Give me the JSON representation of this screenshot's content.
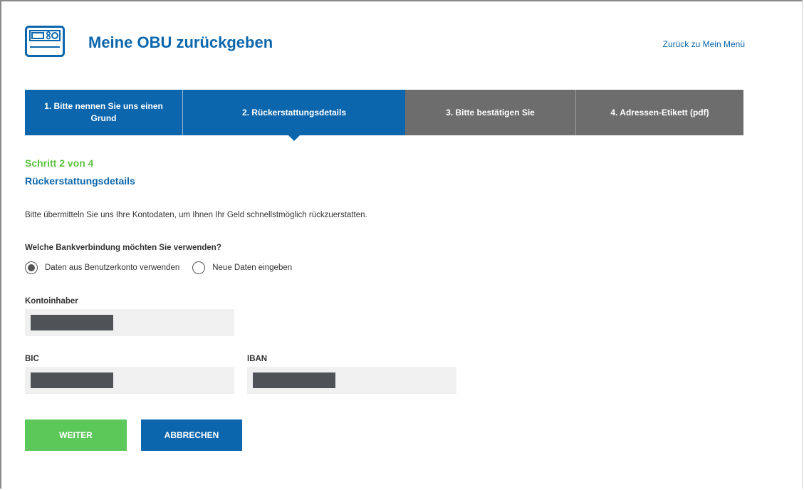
{
  "header": {
    "title": "Meine OBU zurückgeben",
    "back_link": "Zurück zu Mein Menü",
    "logo_icon": "obu-device-icon"
  },
  "steps": [
    {
      "label": "1. Bitte nennen Sie uns einen Grund",
      "state": "done"
    },
    {
      "label": "2. Rückerstattungsdetails",
      "state": "current"
    },
    {
      "label": "3. Bitte bestätigen Sie",
      "state": "upcoming"
    },
    {
      "label": "4. Adressen-Etikett (pdf)",
      "state": "upcoming"
    }
  ],
  "main": {
    "step_count": "Schritt 2 von 4",
    "section_title": "Rückerstattungsdetails",
    "intro": "Bitte übermitteln Sie uns Ihre Kontodaten, um Ihnen Ihr Geld schnellstmöglich rückzuerstatten.",
    "question": "Welche Bankverbindung möchten Sie verwenden?",
    "radio_options": [
      {
        "label": "Daten aus Benutzerkonto verwenden",
        "selected": true
      },
      {
        "label": "Neue Daten eingeben",
        "selected": false
      }
    ],
    "fields": {
      "account_holder_label": "Kontoinhaber",
      "bic_label": "BIC",
      "iban_label": "IBAN"
    }
  },
  "actions": {
    "next_label": "WEITER",
    "cancel_label": "ABBRECHEN"
  },
  "colors": {
    "primary_blue": "#0b66ad",
    "inactive_grey": "#6d6d6d",
    "success_green": "#5cc85a",
    "field_bg": "#f0f0f0",
    "mask": "#4f5257"
  }
}
